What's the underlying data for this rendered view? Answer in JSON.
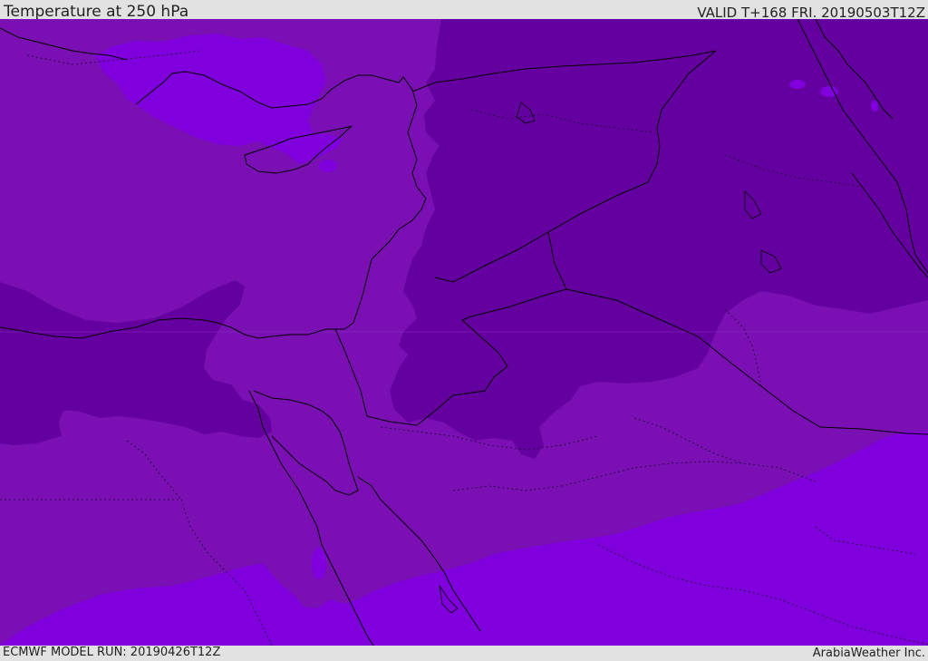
{
  "header": {
    "title": "Temperature at 250 hPa",
    "valid_text": "VALID T+168 FRI. 20190503T12Z"
  },
  "footer": {
    "model_run": "ECMWF MODEL RUN: 20190426T12Z",
    "brand": "ArabiaWeather Inc."
  },
  "map": {
    "colors": {
      "mid_purple": "#7a10b4",
      "dark_purple": "#6500a0",
      "light_violet": "#7f00dc",
      "coastline": "#000000",
      "border": "#000000"
    }
  }
}
